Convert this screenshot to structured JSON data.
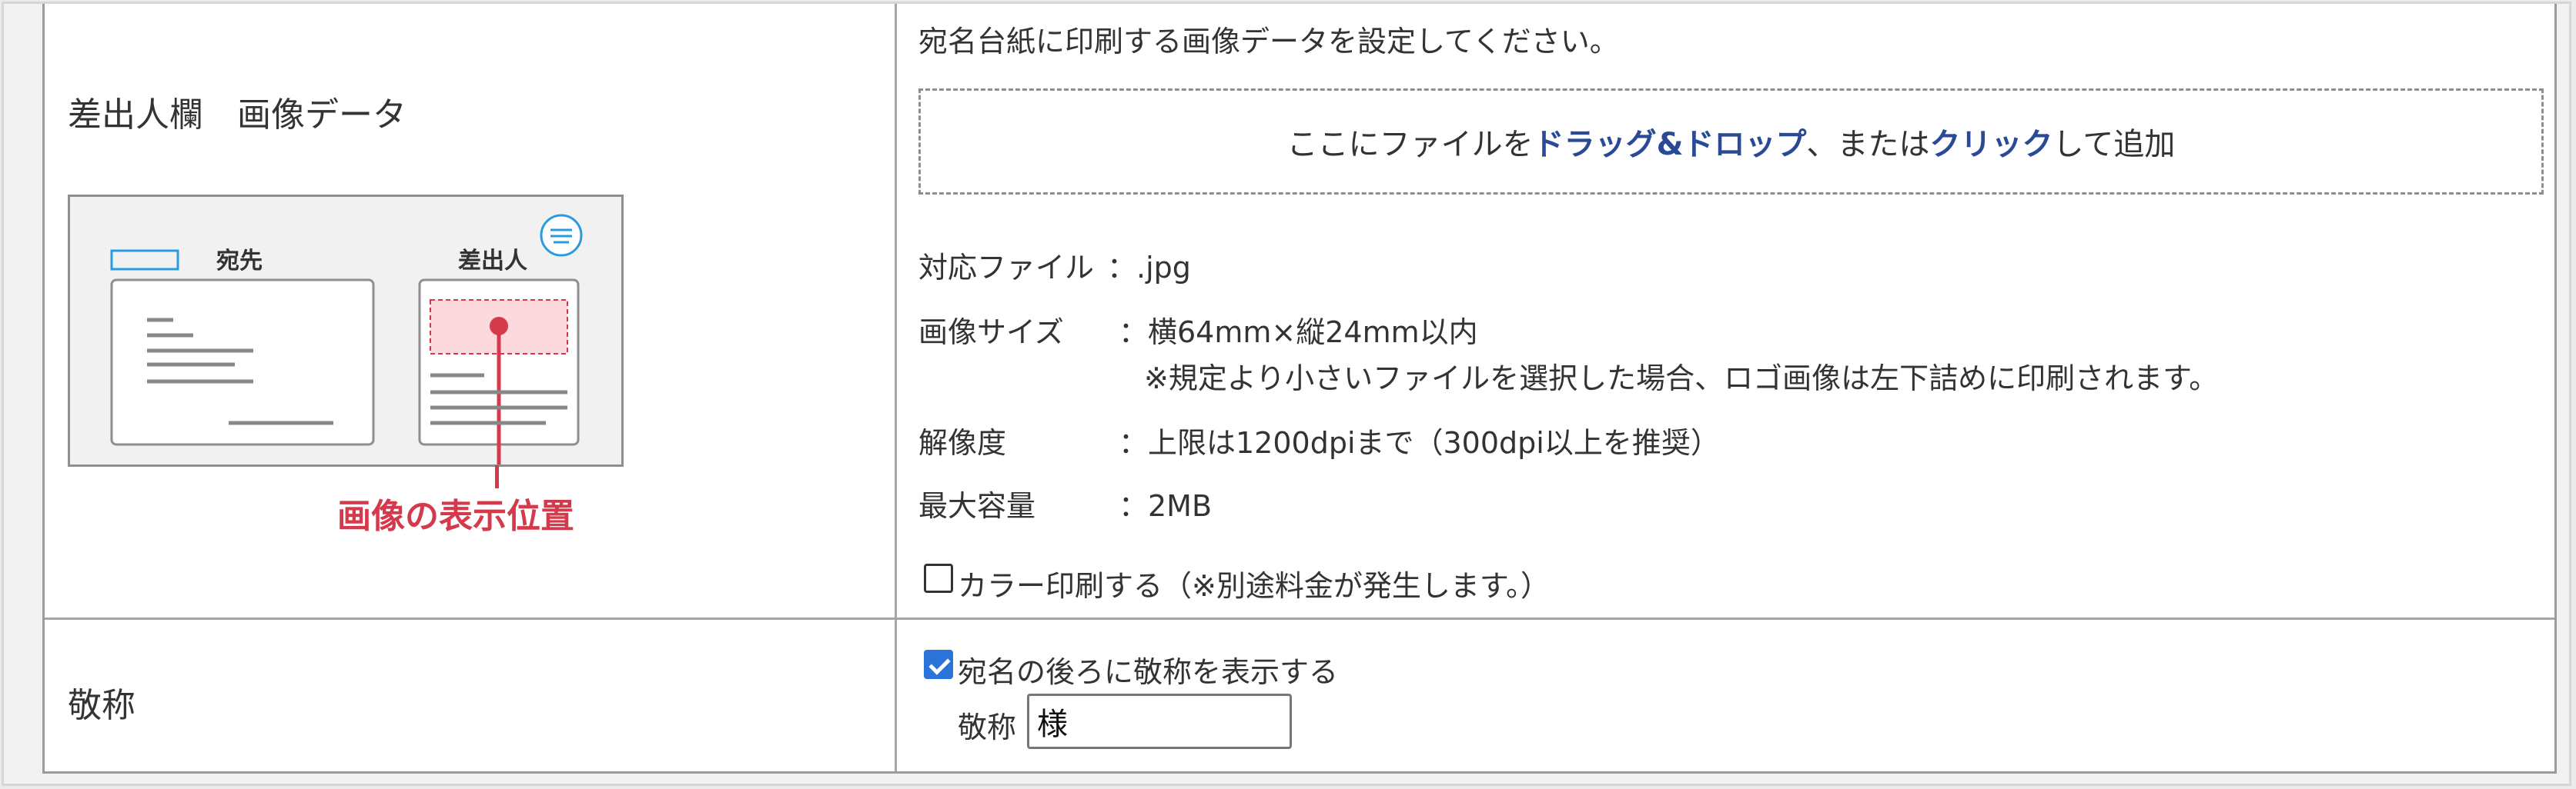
{
  "sender": {
    "label": "差出人欄　画像データ",
    "instruction": "宛名台紙に印刷する画像データを設定してください。",
    "dropzone": {
      "before": "ここにファイルを",
      "drag": "ドラッグ&ドロップ",
      "middle": "、または",
      "click": "クリック",
      "after": "して追加"
    },
    "specs": [
      {
        "key": "対応ファイル",
        "value": "：.jpg"
      },
      {
        "key": "画像サイズ",
        "value": "：横64mm×縦24mm以内"
      },
      {
        "key": "",
        "value": "※規定より小さいファイルを選択した場合、ロゴ画像は左下詰めに印刷されます。"
      },
      {
        "key": "解像度",
        "value": "：上限は1200dpiまで（300dpi以上を推奨）"
      },
      {
        "key": "最大容量",
        "value": "：2MB"
      }
    ],
    "color_print": {
      "label": "カラー印刷する（※別途料金が発生します。）",
      "checked": false
    },
    "illustration": {
      "recipient_label": "宛先",
      "sender_label": "差出人",
      "caption": "画像の表示位置"
    }
  },
  "honorific": {
    "label": "敬称",
    "checkbox": {
      "label": "宛名の後ろに敬称を表示する",
      "checked": true
    },
    "field_label": "敬称",
    "field_value": "様"
  },
  "colors": {
    "link_blue": "#2a4a96",
    "accent_red": "#d43a4c",
    "check_blue": "#2a73d9",
    "icon_blue": "#2a9be0"
  }
}
